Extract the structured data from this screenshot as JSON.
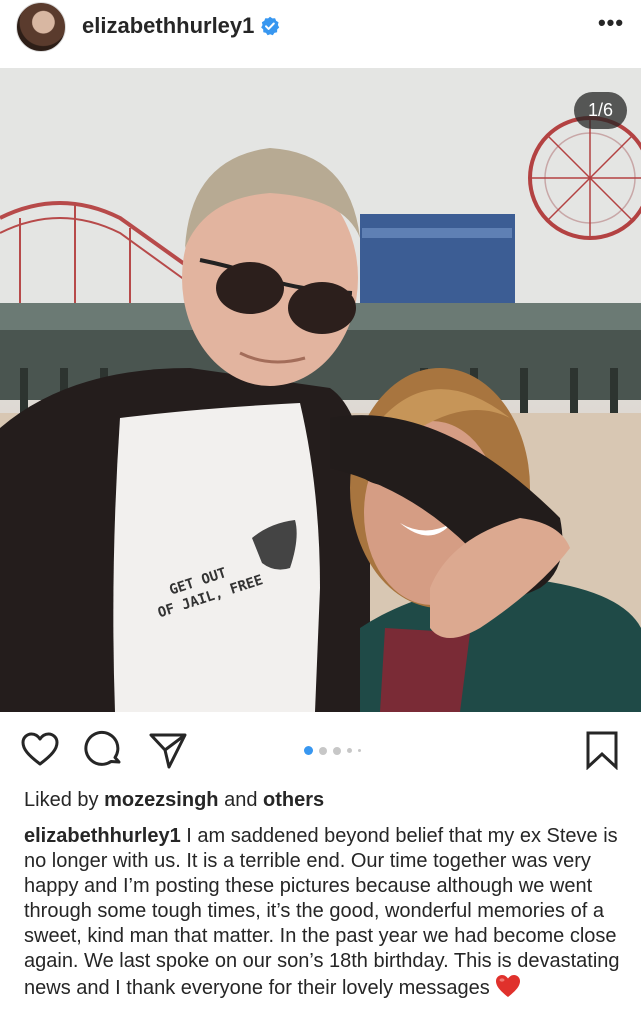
{
  "header": {
    "username": "elizabethhurley1",
    "verified": true,
    "more_glyph": "•••"
  },
  "post": {
    "image_counter": "1/6",
    "image_count": 6,
    "active_image_index": 0,
    "shirt_print": [
      "GET OUT",
      "OF JAIL, FREE"
    ]
  },
  "actions": {
    "icons": [
      "heart-icon",
      "comment-icon",
      "share-icon",
      "bookmark-icon"
    ]
  },
  "likes": {
    "prefix": "Liked by",
    "user": "mozezsingh",
    "and": "and",
    "others": "others"
  },
  "caption": {
    "username": "elizabethhurley1",
    "text": "I am saddened beyond belief that my ex Steve is no longer with us. It is a terrible end. Our time together was very happy and I’m posting these pictures because although we went through some tough times, it’s the good, wonderful memories of a sweet, kind man that matter. In the past year we had become close again. We last spoke on our son’s 18th birthday. This is devastating news and I thank everyone for their lovely messages",
    "emoji": "red-heart"
  },
  "colors": {
    "accent_blue": "#3897f0",
    "verified_blue": "#3897f0",
    "text": "#262626",
    "heart_red": "#e0312c"
  }
}
